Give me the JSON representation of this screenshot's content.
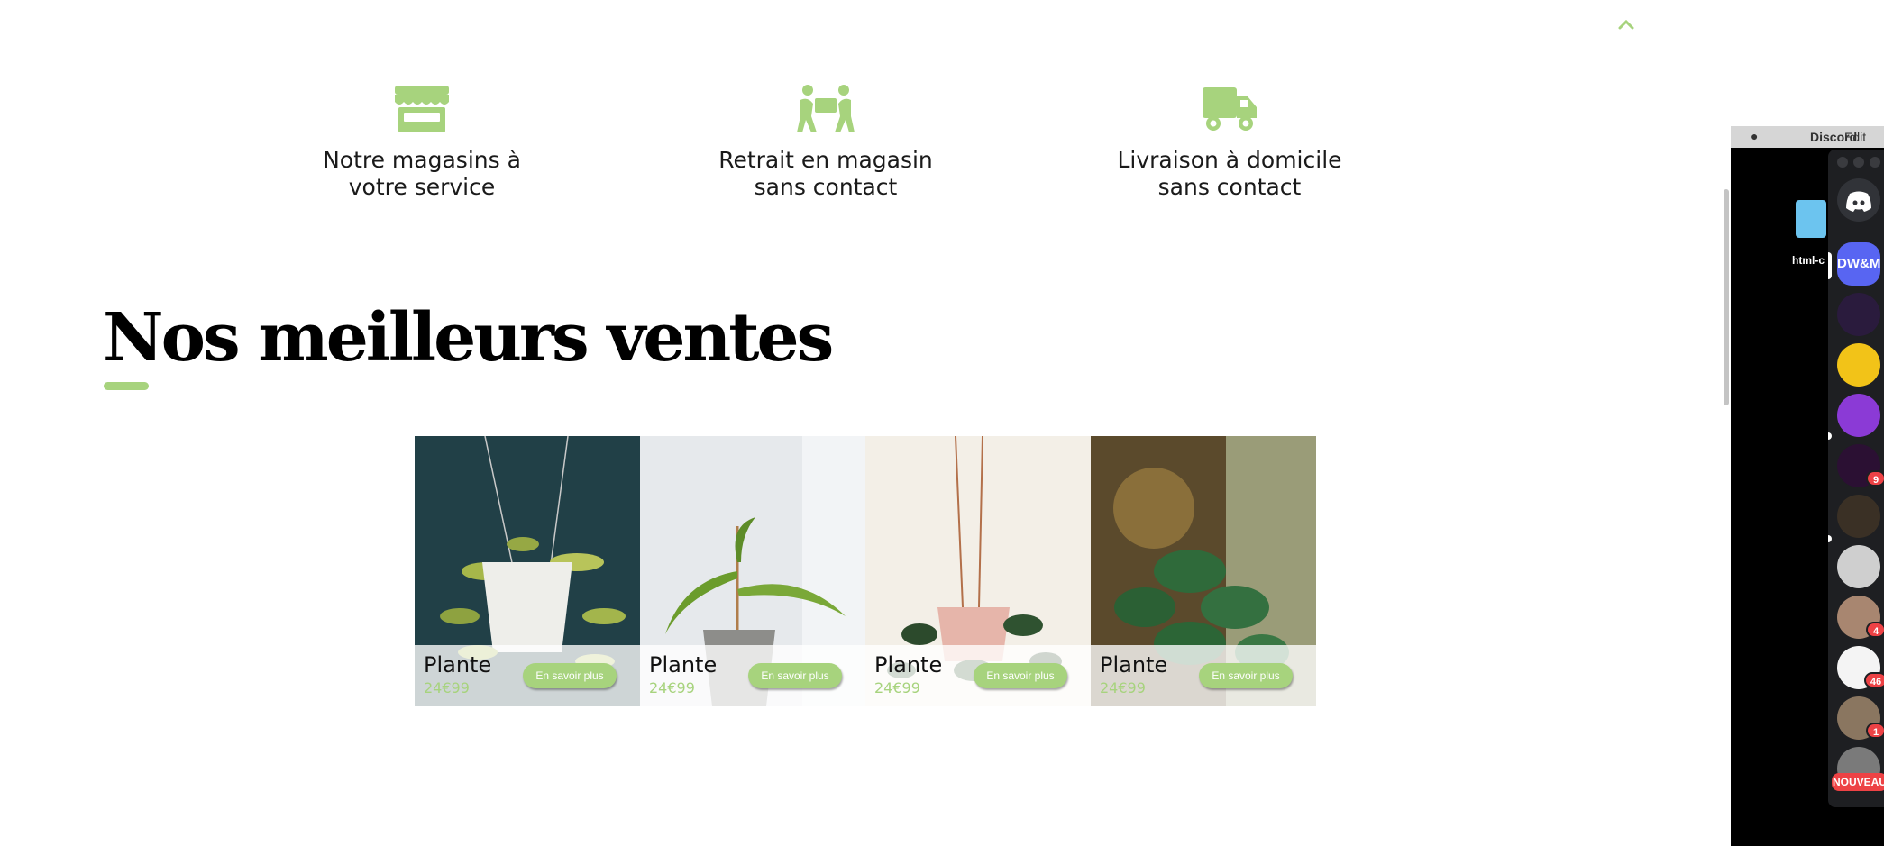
{
  "colors": {
    "accent": "#a7d37d",
    "title": "#000000",
    "discord_bg": "#1e1f22",
    "badge": "#ed4245"
  },
  "scroll_top": {
    "icon": "chevron-up-icon"
  },
  "services": [
    {
      "icon": "store-icon",
      "label": "Notre magasins à\nvotre service"
    },
    {
      "icon": "people-carrying-box-icon",
      "label": "Retrait en magasin\nsans contact"
    },
    {
      "icon": "delivery-truck-icon",
      "label": "Livraison à domicile\nsans contact"
    }
  ],
  "bestsellers": {
    "title": "Nos meilleurs ventes",
    "products": [
      {
        "name": "Plante",
        "price": "24€99",
        "button": "En savoir plus"
      },
      {
        "name": "Plante",
        "price": "24€99",
        "button": "En savoir plus"
      },
      {
        "name": "Plante",
        "price": "24€99",
        "button": "En savoir plus"
      },
      {
        "name": "Plante",
        "price": "24€99",
        "button": "En savoir plus"
      }
    ]
  },
  "desktop": {
    "menubar": {
      "app": "Discord",
      "edit": "Edit"
    },
    "folder_label": "html-c"
  },
  "discord": {
    "servers": [
      {
        "label": "DW&M"
      }
    ],
    "badges": [
      "9",
      "4",
      "46",
      "1"
    ],
    "new_label": "NOUVEAU"
  }
}
